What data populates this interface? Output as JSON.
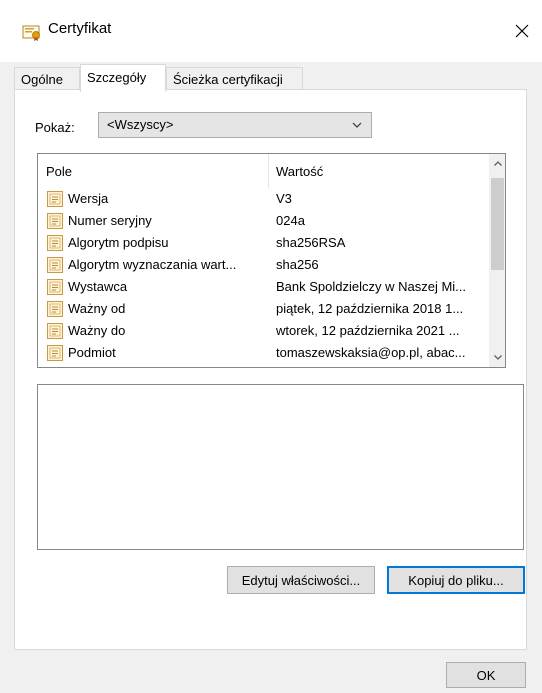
{
  "window": {
    "title": "Certyfikat"
  },
  "tabs": [
    {
      "label": "Ogólne"
    },
    {
      "label": "Szczegóły"
    },
    {
      "label": "Ścieżka certyfikacji"
    }
  ],
  "show": {
    "label": "Pokaż:",
    "selected": "<Wszyscy>"
  },
  "list": {
    "headers": {
      "field": "Pole",
      "value": "Wartość"
    },
    "rows": [
      {
        "field": "Wersja",
        "value": "V3"
      },
      {
        "field": "Numer seryjny",
        "value": "024a"
      },
      {
        "field": "Algorytm podpisu",
        "value": "sha256RSA"
      },
      {
        "field": "Algorytm wyznaczania wart...",
        "value": "sha256"
      },
      {
        "field": "Wystawca",
        "value": "Bank Spoldzielczy w Naszej Mi..."
      },
      {
        "field": "Ważny od",
        "value": "piątek, 12 października 2018 1..."
      },
      {
        "field": "Ważny do",
        "value": "wtorek, 12 października 2021 ..."
      },
      {
        "field": "Podmiot",
        "value": "tomaszewskaksia@op.pl, abac..."
      }
    ]
  },
  "buttons": {
    "edit": "Edytuj właściwości...",
    "copy": "Kopiuj do pliku...",
    "ok": "OK"
  }
}
